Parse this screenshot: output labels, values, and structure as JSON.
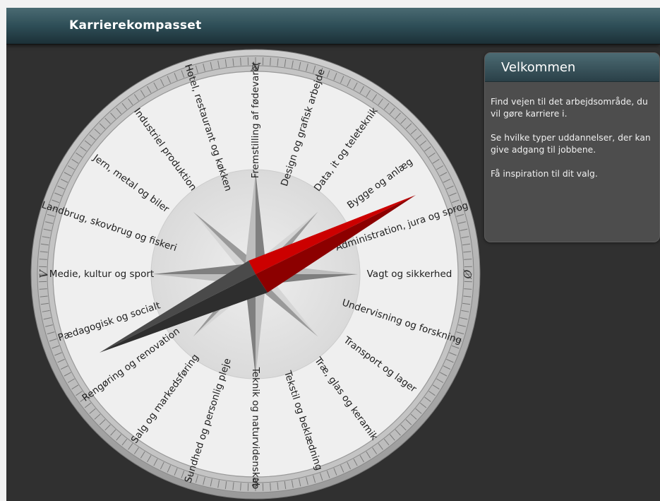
{
  "app": {
    "title": "Karrierekompasset"
  },
  "compass": {
    "cardinals": {
      "north": "N",
      "east": "Ø",
      "south": "S",
      "west": "V"
    },
    "sectors": [
      "Fremstilling af fødevarer",
      "Design og grafisk arbejde",
      "Data, it og teleteknik",
      "Bygge og anlæg",
      "Administration, jura og sprog",
      "Vagt og sikkerhed",
      "Undervisning og forskning",
      "Transport og lager",
      "Træ, glas og keramik",
      "Tekstil og beklædning",
      "Teknik og naturvidenskab",
      "Sundhed og personlig pleje",
      "Salg og markedsføring",
      "Rengøring og renovation",
      "Pædagogisk og socialt",
      "Medie, kultur og sport",
      "Landbrug, skovbrug og fiskeri",
      "Jern, metal og biler",
      "Industriel produktion",
      "Hotel, restaurant og køkken"
    ],
    "needle": {
      "colors": {
        "tip": "#cc0000",
        "tail": "#2e2e2e"
      }
    }
  },
  "welcome": {
    "title": "Velkommen",
    "paragraphs": [
      "Find vejen til det arbejdsområde, du vil gøre karriere i.",
      "Se hvilke typer uddannelser, der kan give adgang til jobbene.",
      "Få inspiration til dit valg."
    ]
  }
}
